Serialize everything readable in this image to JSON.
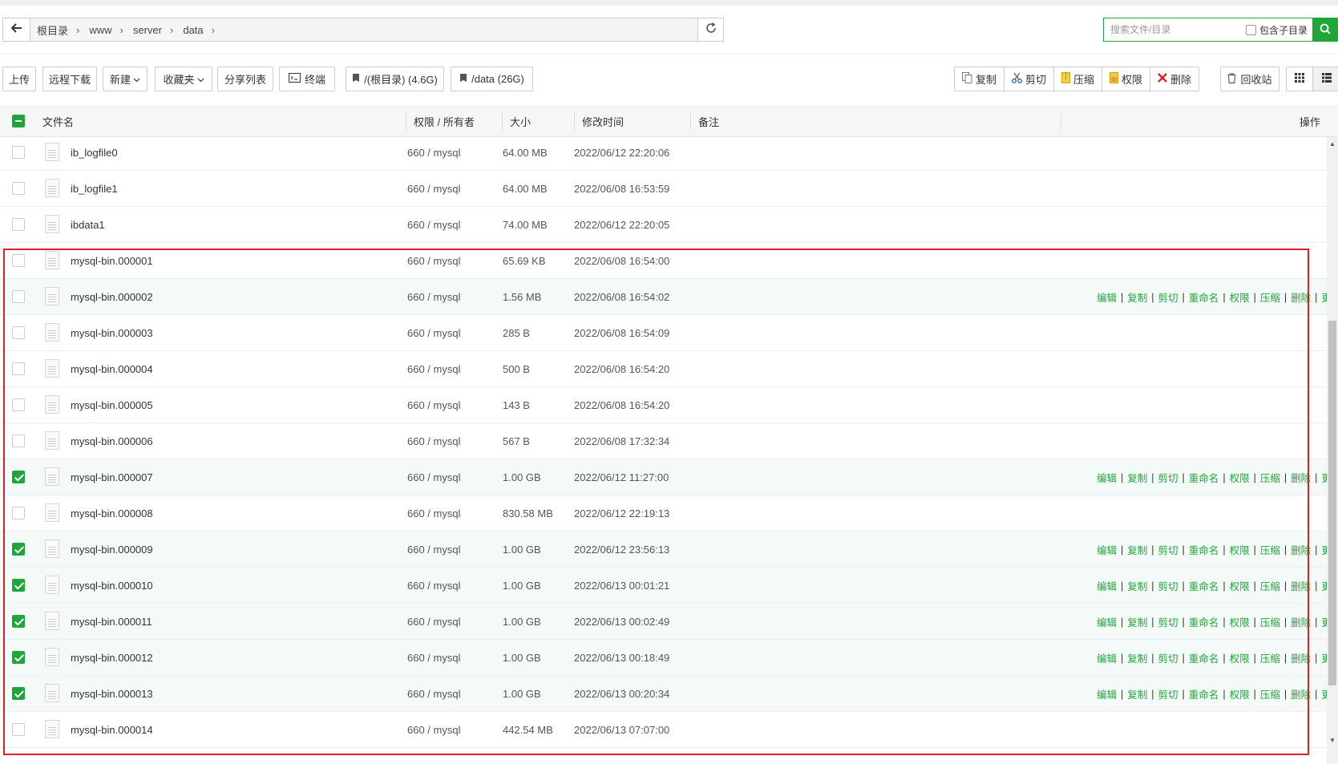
{
  "breadcrumb": {
    "items": [
      "根目录",
      "www",
      "server",
      "data"
    ]
  },
  "search": {
    "placeholder": "搜索文件/目录",
    "include_subdir_label": "包含子目录"
  },
  "toolbar": {
    "upload": "上传",
    "remote_download": "远程下载",
    "new": "新建",
    "favorites": "收藏夹",
    "share_list": "分享列表",
    "terminal": "终端",
    "disk_root": "/(根目录) (4.6G)",
    "disk_data": "/data (26G)",
    "copy": "复制",
    "cut": "剪切",
    "compress": "压缩",
    "permission": "权限",
    "delete": "删除",
    "recycle_bin": "回收站"
  },
  "table": {
    "headers": {
      "name": "文件名",
      "perm": "权限 / 所有者",
      "size": "大小",
      "mtime": "修改时间",
      "remark": "备注",
      "ops": "操作"
    },
    "ops_labels": [
      "编辑",
      "复制",
      "剪切",
      "重命名",
      "权限",
      "压缩",
      "删除",
      "更多"
    ],
    "rows": [
      {
        "name": "ib_logfile0",
        "perm": "660 / mysql",
        "size": "64.00 MB",
        "mtime": "2022/06/12 22:20:06",
        "checked": false,
        "show_ops": false
      },
      {
        "name": "ib_logfile1",
        "perm": "660 / mysql",
        "size": "64.00 MB",
        "mtime": "2022/06/08 16:53:59",
        "checked": false,
        "show_ops": false
      },
      {
        "name": "ibdata1",
        "perm": "660 / mysql",
        "size": "74.00 MB",
        "mtime": "2022/06/12 22:20:05",
        "checked": false,
        "show_ops": false
      },
      {
        "name": "mysql-bin.000001",
        "perm": "660 / mysql",
        "size": "65.69 KB",
        "mtime": "2022/06/08 16:54:00",
        "checked": false,
        "show_ops": false
      },
      {
        "name": "mysql-bin.000002",
        "perm": "660 / mysql",
        "size": "1.56 MB",
        "mtime": "2022/06/08 16:54:02",
        "checked": false,
        "show_ops": true
      },
      {
        "name": "mysql-bin.000003",
        "perm": "660 / mysql",
        "size": "285 B",
        "mtime": "2022/06/08 16:54:09",
        "checked": false,
        "show_ops": false
      },
      {
        "name": "mysql-bin.000004",
        "perm": "660 / mysql",
        "size": "500 B",
        "mtime": "2022/06/08 16:54:20",
        "checked": false,
        "show_ops": false
      },
      {
        "name": "mysql-bin.000005",
        "perm": "660 / mysql",
        "size": "143 B",
        "mtime": "2022/06/08 16:54:20",
        "checked": false,
        "show_ops": false
      },
      {
        "name": "mysql-bin.000006",
        "perm": "660 / mysql",
        "size": "567 B",
        "mtime": "2022/06/08 17:32:34",
        "checked": false,
        "show_ops": false
      },
      {
        "name": "mysql-bin.000007",
        "perm": "660 / mysql",
        "size": "1.00 GB",
        "mtime": "2022/06/12 11:27:00",
        "checked": true,
        "show_ops": true
      },
      {
        "name": "mysql-bin.000008",
        "perm": "660 / mysql",
        "size": "830.58 MB",
        "mtime": "2022/06/12 22:19:13",
        "checked": false,
        "show_ops": false
      },
      {
        "name": "mysql-bin.000009",
        "perm": "660 / mysql",
        "size": "1.00 GB",
        "mtime": "2022/06/12 23:56:13",
        "checked": true,
        "show_ops": true
      },
      {
        "name": "mysql-bin.000010",
        "perm": "660 / mysql",
        "size": "1.00 GB",
        "mtime": "2022/06/13 00:01:21",
        "checked": true,
        "show_ops": true
      },
      {
        "name": "mysql-bin.000011",
        "perm": "660 / mysql",
        "size": "1.00 GB",
        "mtime": "2022/06/13 00:02:49",
        "checked": true,
        "show_ops": true
      },
      {
        "name": "mysql-bin.000012",
        "perm": "660 / mysql",
        "size": "1.00 GB",
        "mtime": "2022/06/13 00:18:49",
        "checked": true,
        "show_ops": true
      },
      {
        "name": "mysql-bin.000013",
        "perm": "660 / mysql",
        "size": "1.00 GB",
        "mtime": "2022/06/13 00:20:34",
        "checked": true,
        "show_ops": true
      },
      {
        "name": "mysql-bin.000014",
        "perm": "660 / mysql",
        "size": "442.54 MB",
        "mtime": "2022/06/13 07:07:00",
        "checked": false,
        "show_ops": false
      }
    ]
  },
  "colors": {
    "accent": "#20a53a",
    "highlight_box": "#e02020",
    "row_hover": "#f4faf7"
  }
}
